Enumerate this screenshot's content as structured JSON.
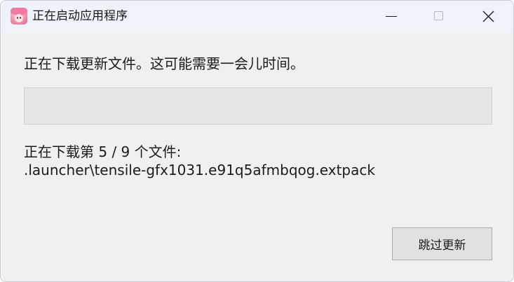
{
  "window": {
    "title": "正在启动应用程序"
  },
  "titlebar_controls": {
    "minimize_icon": "minimize-icon",
    "maximize_icon": "maximize-icon",
    "close_icon": "close-icon"
  },
  "main": {
    "message": "正在下载更新文件。这可能需要一会儿时间。",
    "progress_fraction": 0,
    "status_line": "正在下载第 5 / 9 个文件:",
    "file_path": ".launcher\\tensile-gfx1031.e91q5afmbqog.extpack"
  },
  "footer": {
    "skip_label": "跳过更新"
  },
  "colors": {
    "window_bg": "#f0f0f0",
    "titlebar_bg": "#eef2f9",
    "progress_track": "#e6e6e6",
    "progress_fill": "#06b025",
    "button_bg": "#e1e1e1"
  }
}
